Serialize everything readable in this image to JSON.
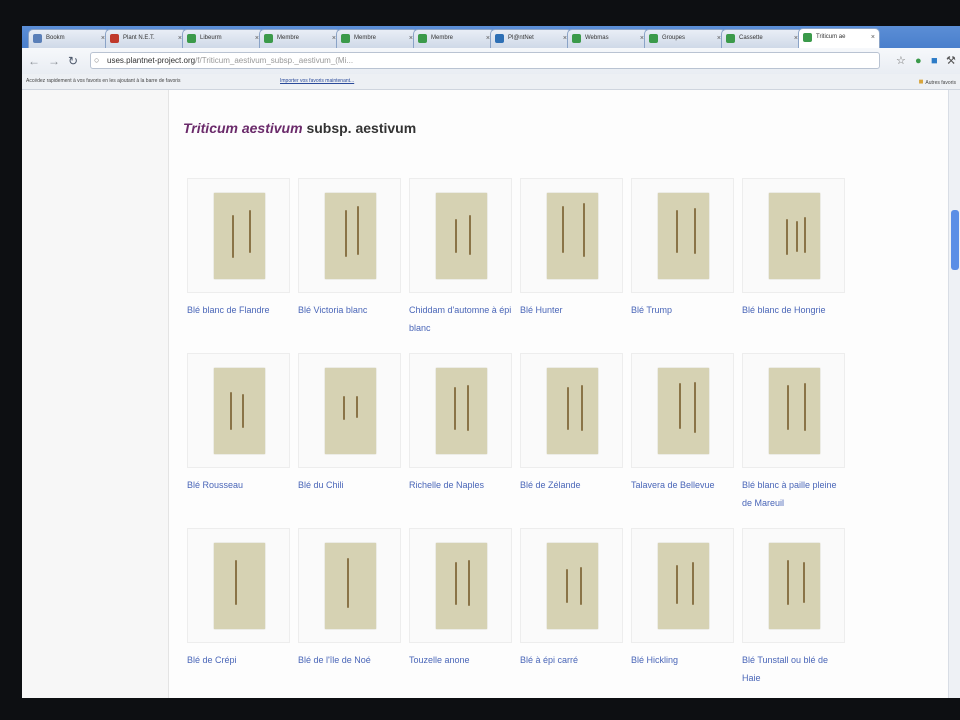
{
  "tabs": [
    {
      "label": "Bookm",
      "active": false
    },
    {
      "label": "Plant N.E.T.",
      "active": false
    },
    {
      "label": "Libeurm",
      "active": false
    },
    {
      "label": "Membre",
      "active": false
    },
    {
      "label": "Membre",
      "active": false
    },
    {
      "label": "Membre",
      "active": false
    },
    {
      "label": "Pl@ntNet",
      "active": false
    },
    {
      "label": "Webmas",
      "active": false
    },
    {
      "label": "Groupes",
      "active": false
    },
    {
      "label": "Cassette",
      "active": false
    },
    {
      "label": "Triticum ae",
      "active": true
    }
  ],
  "toolbar": {
    "url_host": "uses.plantnet-project.org",
    "url_path": "/f/Triticum_aestivum_subsp._aestivum_(Mi...",
    "back_icon": "back-arrow-icon",
    "forward_icon": "forward-arrow-icon",
    "reload_icon": "reload-icon"
  },
  "bookmarks": {
    "info_text": "Accédez rapidement à vos favoris en les ajoutant à la barre de favoris",
    "import_link": "Importer vos favoris maintenant...",
    "other_label": "Autres favoris"
  },
  "page": {
    "title_italic": "Triticum aestivum",
    "title_rest": " subsp. aestivum"
  },
  "varieties": [
    {
      "name": "Blé blanc de Flandre",
      "stalks": [
        [
          0.36,
          0.25,
          0.75
        ],
        [
          0.68,
          0.2,
          0.7
        ]
      ]
    },
    {
      "name": "Blé Victoria blanc",
      "stalks": [
        [
          0.4,
          0.2,
          0.75
        ],
        [
          0.62,
          0.15,
          0.72
        ]
      ]
    },
    {
      "name": "Chiddam d'automne à épi blanc",
      "stalks": [
        [
          0.38,
          0.3,
          0.7
        ],
        [
          0.64,
          0.25,
          0.72
        ]
      ]
    },
    {
      "name": "Blé Hunter",
      "stalks": [
        [
          0.3,
          0.15,
          0.7
        ],
        [
          0.7,
          0.12,
          0.75
        ]
      ]
    },
    {
      "name": "Blé Trump",
      "stalks": [
        [
          0.36,
          0.2,
          0.7
        ],
        [
          0.7,
          0.18,
          0.72
        ]
      ]
    },
    {
      "name": "Blé blanc de Hongrie",
      "stalks": [
        [
          0.34,
          0.3,
          0.72
        ],
        [
          0.52,
          0.32,
          0.68
        ],
        [
          0.68,
          0.28,
          0.7
        ]
      ]
    },
    {
      "name": "Blé Rousseau",
      "stalks": [
        [
          0.32,
          0.28,
          0.72
        ],
        [
          0.54,
          0.3,
          0.7
        ]
      ]
    },
    {
      "name": "Blé du Chili",
      "stalks": [
        [
          0.36,
          0.32,
          0.6
        ],
        [
          0.6,
          0.32,
          0.58
        ]
      ]
    },
    {
      "name": "Richelle de Naples",
      "stalks": [
        [
          0.36,
          0.22,
          0.72
        ],
        [
          0.6,
          0.2,
          0.74
        ]
      ]
    },
    {
      "name": "Blé de Zélande",
      "stalks": [
        [
          0.4,
          0.22,
          0.72
        ],
        [
          0.66,
          0.2,
          0.74
        ]
      ]
    },
    {
      "name": "Talavera de Bellevue",
      "stalks": [
        [
          0.42,
          0.18,
          0.72
        ],
        [
          0.7,
          0.16,
          0.75
        ]
      ]
    },
    {
      "name": "Blé blanc à paille pleine de Mareuil",
      "stalks": [
        [
          0.36,
          0.2,
          0.72
        ],
        [
          0.68,
          0.18,
          0.74
        ]
      ]
    },
    {
      "name": "Blé de Crépi",
      "stalks": [
        [
          0.42,
          0.2,
          0.72
        ]
      ]
    },
    {
      "name": "Blé de l'île de Noé",
      "stalks": [
        [
          0.44,
          0.18,
          0.76
        ]
      ]
    },
    {
      "name": "Touzelle anone",
      "stalks": [
        [
          0.38,
          0.22,
          0.72
        ],
        [
          0.62,
          0.2,
          0.74
        ]
      ]
    },
    {
      "name": "Blé à épi carré",
      "stalks": [
        [
          0.38,
          0.3,
          0.7
        ],
        [
          0.64,
          0.28,
          0.72
        ]
      ]
    },
    {
      "name": "Blé Hickling",
      "stalks": [
        [
          0.36,
          0.25,
          0.7
        ],
        [
          0.66,
          0.22,
          0.72
        ]
      ]
    },
    {
      "name": "Blé Tunstall ou blé de Haie",
      "stalks": [
        [
          0.36,
          0.2,
          0.72
        ],
        [
          0.66,
          0.22,
          0.7
        ]
      ]
    }
  ],
  "colors": {
    "accent": "#4a66b8",
    "title_italic": "#6b2b6b",
    "sheet": "#d6d2b3"
  }
}
